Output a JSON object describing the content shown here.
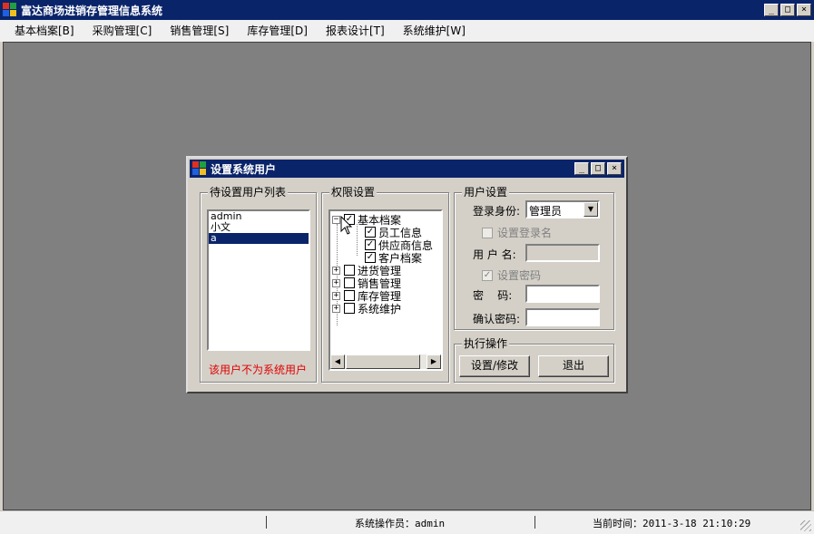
{
  "app": {
    "title": "富达商场进销存管理信息系统",
    "window_buttons": {
      "minimize": "_",
      "maximize": "□",
      "close": "×"
    }
  },
  "menu": [
    {
      "label": "基本档案[B]"
    },
    {
      "label": "采购管理[C]"
    },
    {
      "label": "销售管理[S]"
    },
    {
      "label": "库存管理[D]"
    },
    {
      "label": "报表设计[T]"
    },
    {
      "label": "系统维护[W]"
    }
  ],
  "status": {
    "operator": "系统操作员：admin",
    "time": "当前时间：2011-3-18 21:10:29"
  },
  "dialog": {
    "title": "设置系统用户",
    "window_buttons": {
      "minimize": "_",
      "maximize": "□",
      "close": "×"
    },
    "user_list": {
      "label": "待设置用户列表",
      "items": [
        "admin",
        "小文",
        "a"
      ],
      "selected_index": 2,
      "warning": "该用户不为系统用户"
    },
    "permissions": {
      "label": "权限设置",
      "tree": [
        {
          "label": "基本档案",
          "expander": "−",
          "checked": true
        },
        {
          "label": "员工信息",
          "checked": true
        },
        {
          "label": "供应商信息",
          "checked": true
        },
        {
          "label": "客户档案",
          "checked": true
        },
        {
          "label": "进货管理",
          "expander": "+",
          "checked": false
        },
        {
          "label": "销售管理",
          "expander": "+",
          "checked": false
        },
        {
          "label": "库存管理",
          "expander": "+",
          "checked": false
        },
        {
          "label": "系统维护",
          "expander": "+",
          "checked": false
        }
      ],
      "scroll_left": "◀",
      "scroll_right": "▶"
    },
    "user_settings": {
      "label": "用户设置",
      "role_label": "登录身份:",
      "role_value": "管理员",
      "set_login_name_label": "设置登录名",
      "set_login_name_checked": false,
      "username_label": "用 户 名:",
      "username_value": "",
      "set_password_label": "设置密码",
      "set_password_checked": true,
      "password_label": "密    码:",
      "password_value": "",
      "confirm_password_label": "确认密码:",
      "confirm_password_value": ""
    },
    "actions": {
      "label": "执行操作",
      "save_label": "设置/修改",
      "exit_label": "退出"
    }
  }
}
